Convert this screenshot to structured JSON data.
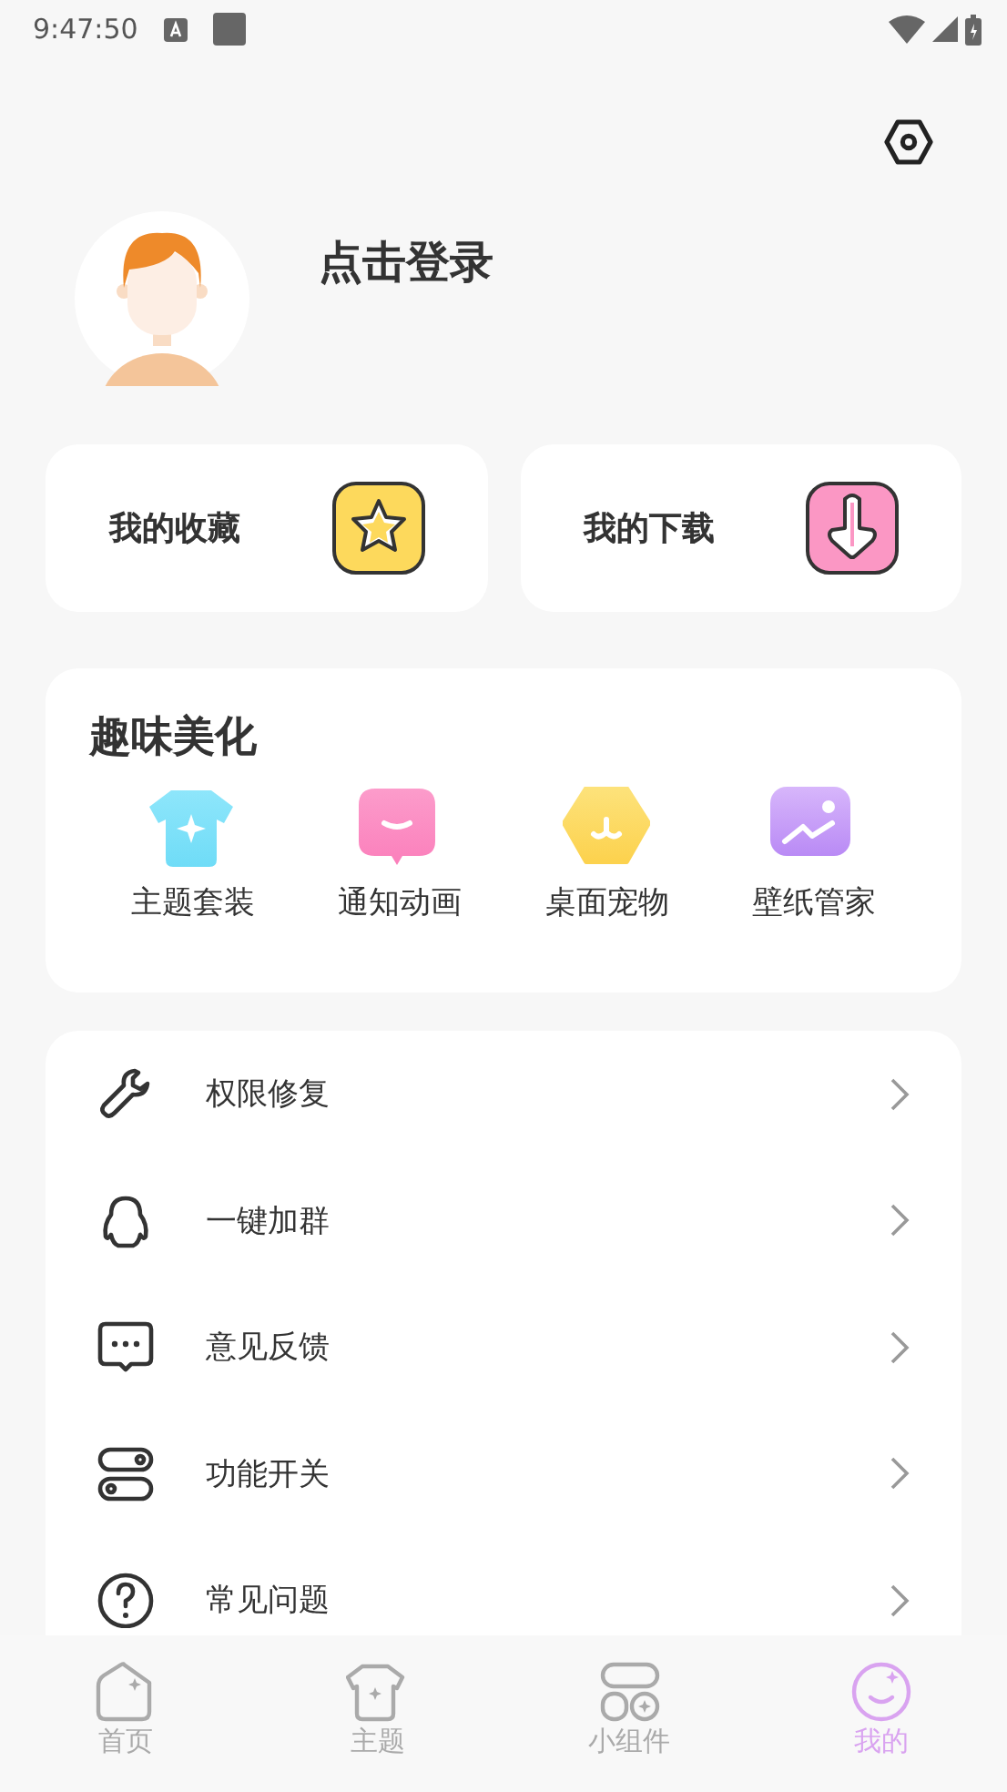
{
  "status_bar": {
    "time": "9:47:50"
  },
  "profile": {
    "login_text": "点击登录"
  },
  "shortcuts": [
    {
      "label": "我的收藏",
      "kind": "star"
    },
    {
      "label": "我的下载",
      "kind": "download"
    }
  ],
  "fun_section": {
    "title": "趣味美化",
    "items": [
      {
        "label": "主题套装",
        "kind": "shirt"
      },
      {
        "label": "通知动画",
        "kind": "bubble"
      },
      {
        "label": "桌面宠物",
        "kind": "pet"
      },
      {
        "label": "壁纸管家",
        "kind": "wallpaper"
      }
    ]
  },
  "menu": [
    {
      "label": "权限修复",
      "kind": "wrench"
    },
    {
      "label": "一键加群",
      "kind": "penguin"
    },
    {
      "label": "意见反馈",
      "kind": "chat"
    },
    {
      "label": "功能开关",
      "kind": "toggles"
    },
    {
      "label": "常见问题",
      "kind": "help"
    }
  ],
  "tabs": [
    {
      "label": "首页",
      "kind": "home",
      "selected": false
    },
    {
      "label": "主题",
      "kind": "shirt",
      "selected": false
    },
    {
      "label": "小组件",
      "kind": "widgets",
      "selected": false
    },
    {
      "label": "我的",
      "kind": "smile",
      "selected": true
    }
  ]
}
